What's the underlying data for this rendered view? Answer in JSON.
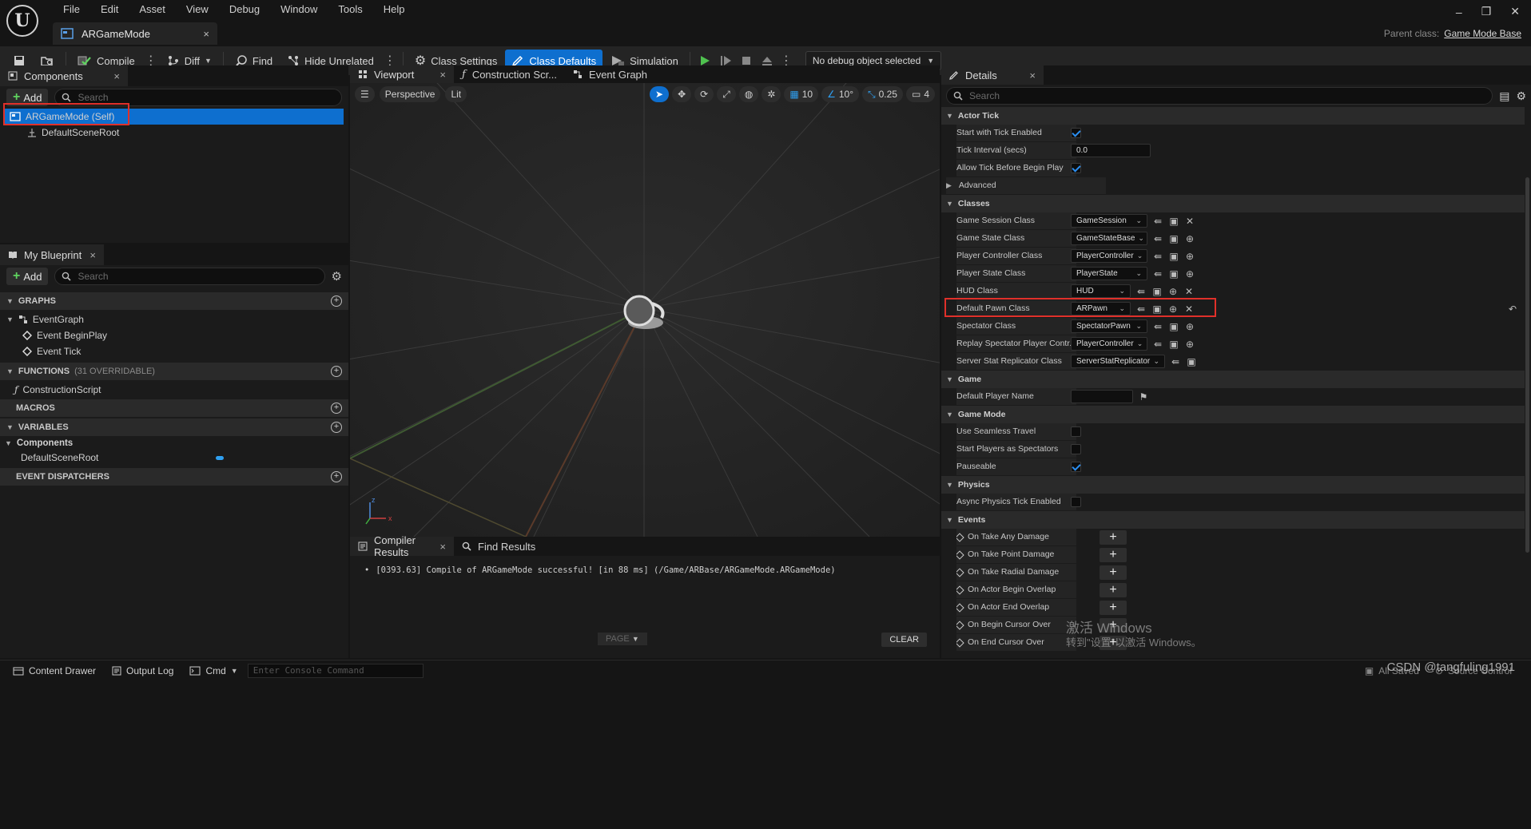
{
  "menu": [
    "File",
    "Edit",
    "Asset",
    "View",
    "Debug",
    "Window",
    "Tools",
    "Help"
  ],
  "doc_tab": {
    "label": "ARGameMode",
    "close": "×"
  },
  "window_controls": {
    "minimize": "–",
    "restore": "❐",
    "close": "✕"
  },
  "parent_class": {
    "label": "Parent class:",
    "value": "Game Mode Base"
  },
  "toolbar": {
    "compile": "Compile",
    "diff": "Diff",
    "find": "Find",
    "hide_unrelated": "Hide Unrelated",
    "class_settings": "Class Settings",
    "class_defaults": "Class Defaults",
    "simulation": "Simulation",
    "debug_object": "No debug object selected"
  },
  "components": {
    "tab": "Components",
    "add": "Add",
    "search_placeholder": "Search",
    "items": [
      "ARGameMode (Self)",
      "DefaultSceneRoot"
    ]
  },
  "my_blueprint": {
    "tab": "My Blueprint",
    "add": "Add",
    "search_placeholder": "Search",
    "graphs": "GRAPHS",
    "event_graph": "EventGraph",
    "events": [
      "Event BeginPlay",
      "Event Tick"
    ],
    "functions": "FUNCTIONS",
    "functions_note": "(31 OVERRIDABLE)",
    "construction_script": "ConstructionScript",
    "macros": "MACROS",
    "variables": "VARIABLES",
    "var_group": "Components",
    "var_item": "DefaultSceneRoot",
    "dispatchers": "EVENT DISPATCHERS"
  },
  "viewport": {
    "tabs": [
      "Viewport",
      "Construction Scr...",
      "Event Graph"
    ],
    "perspective": "Perspective",
    "lit": "Lit",
    "grid_snap": "10",
    "rot_snap": "10°",
    "scale_snap": "0.25",
    "cam_speed": "4"
  },
  "compiler": {
    "tabs": [
      "Compiler Results",
      "Find Results"
    ],
    "message": "[0393.63] Compile of ARGameMode successful! [in 88 ms] (/Game/ARBase/ARGameMode.ARGameMode)",
    "page": "PAGE",
    "clear": "CLEAR"
  },
  "details": {
    "tab": "Details",
    "search_placeholder": "Search",
    "sections": {
      "actor_tick": "Actor Tick",
      "classes": "Classes",
      "game": "Game",
      "game_mode": "Game Mode",
      "physics": "Physics",
      "events": "Events"
    },
    "actor_tick": {
      "start_tick": "Start with Tick Enabled",
      "tick_interval": "Tick Interval (secs)",
      "tick_interval_value": "0.0",
      "allow_tick": "Allow Tick Before Begin Play",
      "advanced": "Advanced"
    },
    "classes": [
      {
        "name": "Game Session Class",
        "value": "GameSession"
      },
      {
        "name": "Game State Class",
        "value": "GameStateBase"
      },
      {
        "name": "Player Controller Class",
        "value": "PlayerController"
      },
      {
        "name": "Player State Class",
        "value": "PlayerState"
      },
      {
        "name": "HUD Class",
        "value": "HUD"
      },
      {
        "name": "Default Pawn Class",
        "value": "ARPawn"
      },
      {
        "name": "Spectator Class",
        "value": "SpectatorPawn"
      },
      {
        "name": "Replay Spectator Player Contr...",
        "value": "PlayerController"
      },
      {
        "name": "Server Stat Replicator Class",
        "value": "ServerStatReplicator"
      }
    ],
    "game": {
      "default_player_name": "Default Player Name"
    },
    "game_mode": {
      "seamless": "Use Seamless Travel",
      "spectators": "Start Players as Spectators",
      "pauseable": "Pauseable"
    },
    "physics": {
      "async": "Async Physics Tick Enabled"
    },
    "events": [
      "On Take Any Damage",
      "On Take Point Damage",
      "On Take Radial Damage",
      "On Actor Begin Overlap",
      "On Actor End Overlap",
      "On Begin Cursor Over",
      "On End Cursor Over"
    ]
  },
  "statusbar": {
    "content_drawer": "Content Drawer",
    "output_log": "Output Log",
    "cmd": "Cmd",
    "console_placeholder": "Enter Console Command",
    "all_saved": "All Saved",
    "source_control": "Source Control"
  },
  "watermark": {
    "line1": "激活 Windows",
    "line2": "转到\"设置\"以激活 Windows。",
    "csdn": "CSDN @tangfuling1991"
  }
}
